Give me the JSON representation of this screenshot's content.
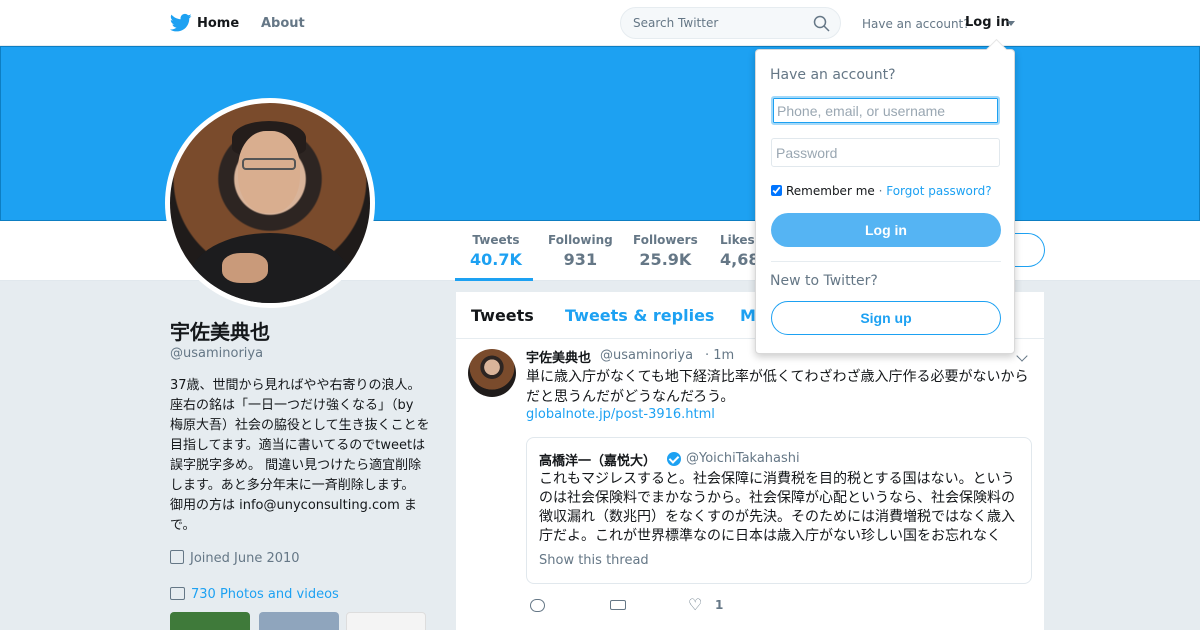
{
  "nav": {
    "home": "Home",
    "about": "About",
    "search_placeholder": "Search Twitter",
    "have_account": "Have an account?",
    "login": "Log in"
  },
  "profile_nav": {
    "stats": [
      {
        "label": "Tweets",
        "value": "40.7K"
      },
      {
        "label": "Following",
        "value": "931"
      },
      {
        "label": "Followers",
        "value": "25.9K"
      },
      {
        "label": "Likes",
        "value": "4,68"
      }
    ]
  },
  "profile": {
    "name": "宇佐美典也",
    "handle": "@usaminoriya",
    "bio": "37歳、世間から見ればやや右寄りの浪人。 座右の銘は「一日一つだけ強くなる」（by 梅原大吾）社会の脇役として生き抜くことを目指してます。適当に書いてるのでtweetは誤字脱字多め。 間違い見つけたら適宜削除します。あと多分年末に一斉削除します。 御用の方は info@unyconsulting.com まで。",
    "joined": "Joined June 2010",
    "photos": "730 Photos and videos"
  },
  "timeline": {
    "tabs": [
      "Tweets",
      "Tweets & replies",
      "M"
    ],
    "tweet": {
      "name": "宇佐美典也",
      "handle": "@usaminoriya",
      "time": "· 1m",
      "text": "単に歳入庁がなくても地下経済比率が低くてわざわざ歳入庁作る必要がないからだと思うんだがどうなんだろう。",
      "link": "globalnote.jp/post-3916.html",
      "quote": {
        "name": "高橋洋一（嘉悦大）",
        "handle": "@YoichiTakahashi",
        "text": "これもマジレスすると。社会保障に消費税を目的税とする国はない。というのは社会保険料でまかなうから。社会保障が心配というなら、社会保険料の徴収漏れ（数兆円）をなくすのが先決。そのためには消費増税ではなく歳入庁だよ。これが世界標準なのに日本は歳入庁がない珍しい国をお忘れなく",
        "show_thread": "Show this thread"
      },
      "like_count": "1"
    }
  },
  "login_dropdown": {
    "title": "Have an account?",
    "username_placeholder": "Phone, email, or username",
    "password_placeholder": "Password",
    "remember": "Remember me",
    "separator": " · ",
    "forgot": "Forgot password?",
    "login_button": "Log in",
    "new_to_twitter": "New to Twitter?",
    "signup_button": "Sign up"
  },
  "colors": {
    "brand": "#1da1f2",
    "background": "#e6ecf0"
  },
  "icons": [
    "twitter-bird-icon",
    "search-icon",
    "caret-down-icon",
    "calendar-icon",
    "image-icon",
    "reply-icon",
    "retweet-icon",
    "heart-icon",
    "verified-badge-icon",
    "chevron-down-icon"
  ]
}
